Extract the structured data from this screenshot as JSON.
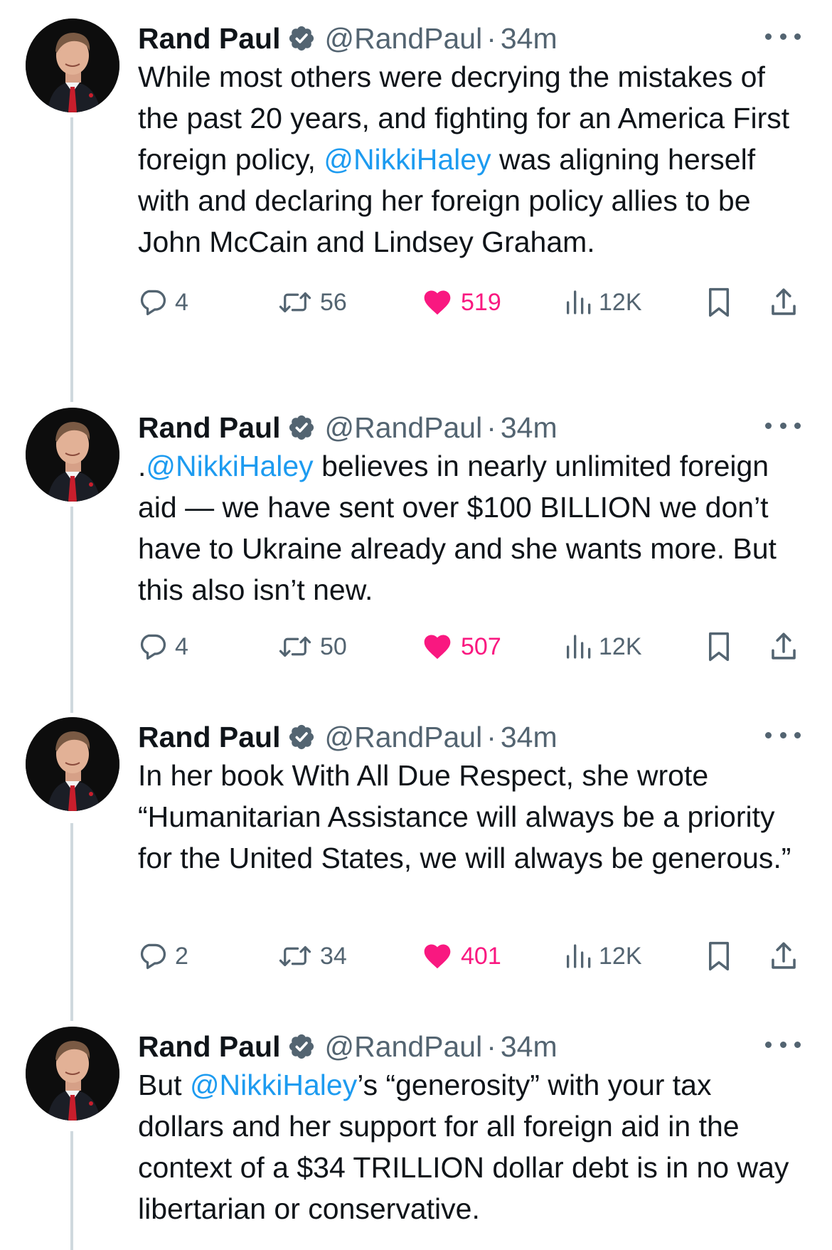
{
  "colors": {
    "text": "#0f1419",
    "secondary": "#536471",
    "mention": "#1d9bf0",
    "like": "#f91880",
    "thread_line": "#cfd9de"
  },
  "tweets": [
    {
      "author": "Rand Paul",
      "handle": "@RandPaul",
      "separator": "·",
      "time": "34m",
      "text": [
        {
          "t": "While most others were decrying the mistakes of the past 20 years, and fighting for an America First foreign policy, "
        },
        {
          "t": "@NikkiHaley",
          "mention": true
        },
        {
          "t": " was aligning herself with and declaring her foreign policy allies to be John McCain and Lindsey Graham."
        }
      ],
      "replies": "4",
      "reposts": "56",
      "likes": "519",
      "views": "12K"
    },
    {
      "author": "Rand Paul",
      "handle": "@RandPaul",
      "separator": "·",
      "time": "34m",
      "text": [
        {
          "t": "."
        },
        {
          "t": "@NikkiHaley",
          "mention": true
        },
        {
          "t": " believes in nearly unlimited foreign aid — we have sent over $100 BILLION we don’t have to Ukraine already and she wants more. But this also isn’t new."
        }
      ],
      "replies": "4",
      "reposts": "50",
      "likes": "507",
      "views": "12K"
    },
    {
      "author": "Rand Paul",
      "handle": "@RandPaul",
      "separator": "·",
      "time": "34m",
      "text": [
        {
          "t": "In her book With All Due Respect, she wrote “Humanitarian Assistance will always be a priority for the United States, we will always be generous.”"
        }
      ],
      "replies": "2",
      "reposts": "34",
      "likes": "401",
      "views": "12K"
    },
    {
      "author": "Rand Paul",
      "handle": "@RandPaul",
      "separator": "·",
      "time": "34m",
      "text": [
        {
          "t": "But "
        },
        {
          "t": "@NikkiHaley",
          "mention": true
        },
        {
          "t": "’s “generosity” with your tax dollars and her support for all foreign aid in the context of a $34 TRILLION dollar debt is in no way libertarian or conservative."
        }
      ]
    }
  ]
}
